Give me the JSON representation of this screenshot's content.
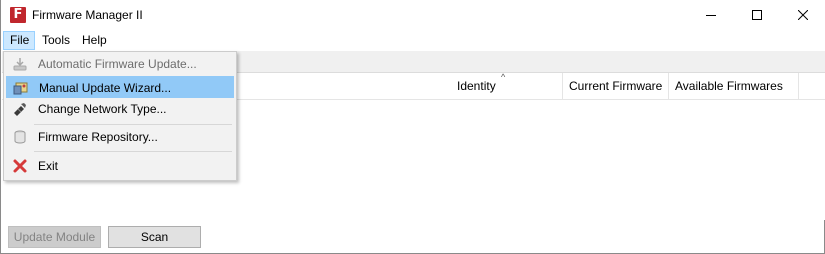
{
  "window": {
    "title": "Firmware Manager II",
    "app_icon_letter": "F",
    "accent_color": "#c0272d"
  },
  "menubar": {
    "file": "File",
    "tools": "Tools",
    "help": "Help"
  },
  "file_menu": {
    "items": [
      {
        "label": "Automatic Firmware Update...",
        "icon": "download-icon",
        "disabled": true
      },
      {
        "label": "Manual Update Wizard...",
        "icon": "wizard-icon",
        "highlighted": true
      },
      {
        "label": "Change Network Type...",
        "icon": "network-cable-icon"
      },
      {
        "label": "Firmware Repository...",
        "icon": "database-icon"
      },
      {
        "label": "Exit",
        "icon": "close-x-icon"
      }
    ]
  },
  "table": {
    "columns": [
      "Identity",
      "Current Firmware",
      "Available Firmwares"
    ],
    "sort_indicator": "^"
  },
  "buttons": {
    "update_module": "Update Module",
    "scan": "Scan"
  }
}
